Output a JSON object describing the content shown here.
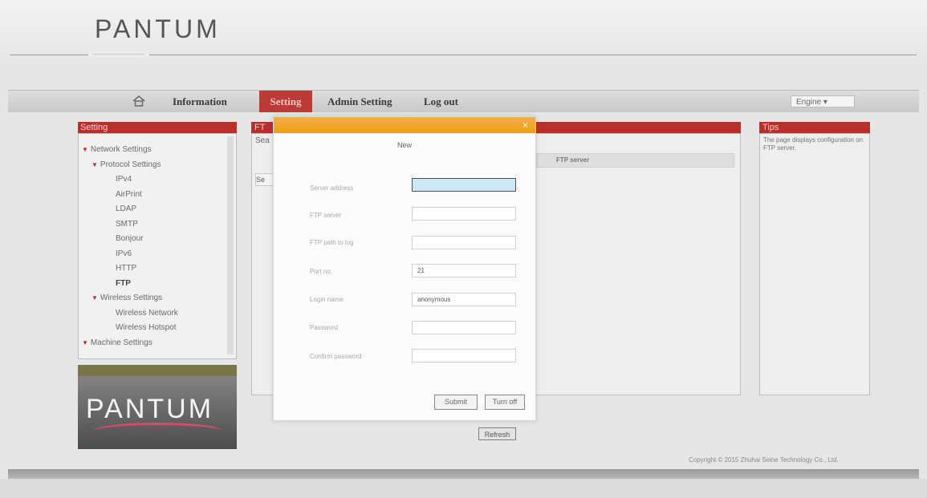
{
  "header": {
    "logo": "PANTUM",
    "tagline": "————————"
  },
  "nav": {
    "home_icon": "home-icon",
    "items": [
      "Information",
      "Setting",
      "Admin Setting",
      "Log out"
    ],
    "active": "Setting",
    "language": "Engine ▾"
  },
  "sidebar": {
    "title": "Setting",
    "tree": [
      {
        "label": "Network Settings",
        "level": 0,
        "arrow": true
      },
      {
        "label": "Protocol Settings",
        "level": 1,
        "arrow": true
      },
      {
        "label": "IPv4",
        "level": 2
      },
      {
        "label": "AirPrint",
        "level": 2
      },
      {
        "label": "LDAP",
        "level": 2
      },
      {
        "label": "SMTP",
        "level": 2
      },
      {
        "label": "Bonjour",
        "level": 2
      },
      {
        "label": "IPv6",
        "level": 2
      },
      {
        "label": "HTTP",
        "level": 2
      },
      {
        "label": "FTP",
        "level": 2,
        "active": true
      },
      {
        "label": "Wireless Settings",
        "level": 1,
        "arrow": true
      },
      {
        "label": "Wireless Network",
        "level": 2
      },
      {
        "label": "Wireless Hotspot",
        "level": 2
      },
      {
        "label": "Machine Settings",
        "level": 0,
        "arrow": true
      }
    ],
    "banner_logo": "PANTUM"
  },
  "main": {
    "title": "FT",
    "search_label": "Sea",
    "frag_button": "Se",
    "ftp_column": "FTP server",
    "refresh_label": "Refresh"
  },
  "tips": {
    "title": "Tips",
    "text": "The page displays configuration on FTP server."
  },
  "modal": {
    "title": "New",
    "fields": [
      {
        "label": "Server address",
        "value": ""
      },
      {
        "label": "FTP server",
        "value": ""
      },
      {
        "label": "FTP path to log",
        "value": ""
      },
      {
        "label": "Port no.",
        "value": "21"
      },
      {
        "label": "Login name",
        "value": "anonymous"
      },
      {
        "label": "Password",
        "value": ""
      },
      {
        "label": "Confirm password",
        "value": ""
      }
    ],
    "submit_label": "Submit",
    "turnoff_label": "Turn off",
    "accent": "#f0a32a"
  },
  "footer": {
    "copyright": "Copyright © 2015 Zhuhai Seine Technology Co., Ltd."
  }
}
